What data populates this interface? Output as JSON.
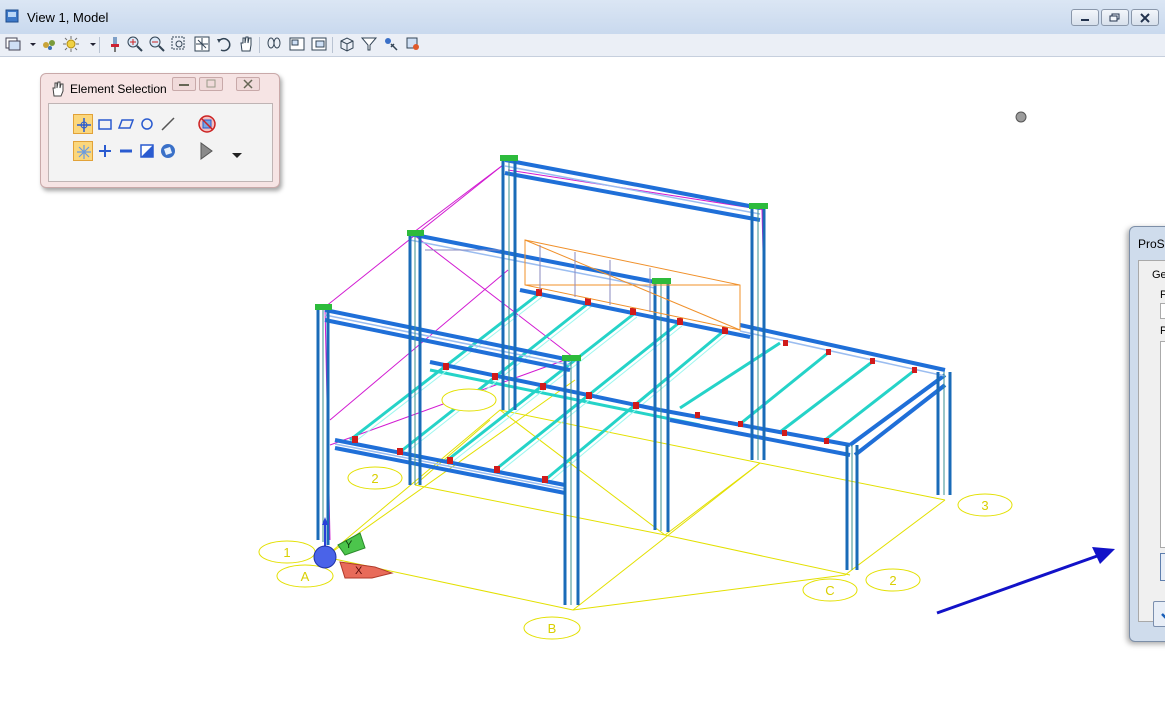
{
  "window": {
    "title": "View 1, Model"
  },
  "element_selection": {
    "title": "Element Selection"
  },
  "prostructures_dialog": {
    "title": "ProSt",
    "tab_label": "Ge",
    "field1_label": "P",
    "field2_label": "P"
  },
  "grid_labels": {
    "row_A": "A",
    "row_B": "B",
    "row_C": "C",
    "col_1": "1",
    "col_2_left": "2",
    "col_2_right": "2",
    "col_3": "3"
  },
  "axis": {
    "x": "X",
    "y": "Y"
  },
  "icons": [
    "view-icon",
    "view-groups-icon",
    "display-style-icon",
    "lighting-icon",
    "paint-icon",
    "zoom-in-icon",
    "zoom-out-icon",
    "window-area-icon",
    "fit-view-icon",
    "rotate-view-icon",
    "pan-view-icon",
    "walk-icon",
    "previous-view-icon",
    "next-view-icon",
    "clip-volume-icon",
    "view-display-icon",
    "selection-icon",
    "change-view-icon"
  ],
  "colors": {
    "steel": "#1f6fd8",
    "joist": "#25d3c8",
    "grid": "#e3e000",
    "magenta": "#d21bd2",
    "arrow": "#1212c8"
  }
}
